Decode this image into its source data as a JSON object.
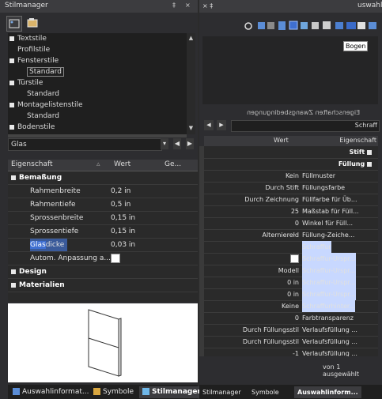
{
  "left": {
    "title": "Stilmanager",
    "pin": "‡",
    "close": "×",
    "tree": [
      {
        "label": "Textstile",
        "level": 0,
        "expanded": true
      },
      {
        "label": "Profilstile",
        "level": 1
      },
      {
        "label": "Fensterstile",
        "level": 0,
        "expanded": true
      },
      {
        "label": "Standard",
        "level": 2,
        "selected": true
      },
      {
        "label": "Türstile",
        "level": 0,
        "expanded": true
      },
      {
        "label": "Standard",
        "level": 2
      },
      {
        "label": "Montagelistenstile",
        "level": 0,
        "expanded": true
      },
      {
        "label": "Standard",
        "level": 2
      },
      {
        "label": "Bodenstile",
        "level": 0
      }
    ],
    "filter_value": "Glas",
    "prop_headers": {
      "name": "Eigenschaft",
      "value": "Wert",
      "ge": "Ge..."
    },
    "groups": [
      {
        "name": "Bemaßung",
        "rows": [
          {
            "name": "Rahmenbreite",
            "value": "0,2 in"
          },
          {
            "name": "Rahmentiefe",
            "value": "0,5 in"
          },
          {
            "name": "Sprossenbreite",
            "value": "0,15 in"
          },
          {
            "name": "Sprossentiefe",
            "value": "0,15 in"
          },
          {
            "name": "Glasdicke",
            "value": "0,03 in",
            "highlight": "Glas"
          },
          {
            "name": "Autom. Anpassung a...",
            "value": "",
            "checkbox": true
          }
        ]
      },
      {
        "name": "Design",
        "rows": []
      },
      {
        "name": "Materialien",
        "rows": []
      }
    ],
    "tabs": [
      "Auswahlinformat...",
      "Symbole",
      "Stilmanager"
    ]
  },
  "right": {
    "title": "uswahl",
    "pin": "× ‡",
    "bogen": "Bogen",
    "tabs_mirrored": "Eigenschaften  Zwangsbedingungen",
    "selector_value": "Schraff",
    "head": {
      "name": "Eigenschaft",
      "value": "Wert"
    },
    "rows": [
      {
        "name": "Stift",
        "value": "",
        "group": true
      },
      {
        "name": "Füllung",
        "value": "",
        "group": true
      },
      {
        "name": "Füllmuster",
        "value": "Kein"
      },
      {
        "name": "Füllungsfarbe",
        "value": "Durch Stift"
      },
      {
        "name": "Füllfarbe für Üb...",
        "value": "Durch Zeichnung"
      },
      {
        "name": "Maßstab für Füll...",
        "value": "25"
      },
      {
        "name": "Winkel für Füll...",
        "value": "0"
      },
      {
        "name": "Füllung-Zeiche...",
        "value": "Alternierełd"
      },
      {
        "name": "Schraffur",
        "value": "",
        "hl": true
      },
      {
        "name": "Schraffur-Urspr...",
        "value": "",
        "hl": true,
        "checkbox": true
      },
      {
        "name": "Schraffur-Urspr...",
        "value": "Modell",
        "hl": true
      },
      {
        "name": "Schraffur-Urspr...",
        "value": "0 in",
        "hl": true
      },
      {
        "name": "Schraffur-Urspr...",
        "value": "0 in",
        "hl": true
      },
      {
        "name": "Schraffurhinter...",
        "value": "Keine",
        "hl": true
      },
      {
        "name": "Farbtransparenz",
        "value": "0"
      },
      {
        "name": "Verlaufsfüllung ...",
        "value": "Durch Füllungsstil"
      },
      {
        "name": "Verlaufsfüllung ...",
        "value": "Durch Füllungsstil"
      },
      {
        "name": "Verlaufsfüllung ...",
        "value": "-1"
      }
    ],
    "status": "von 1 ausgewählt",
    "tabs": [
      "Auswahlinform...",
      "Symbole",
      "Stilmanager"
    ]
  }
}
